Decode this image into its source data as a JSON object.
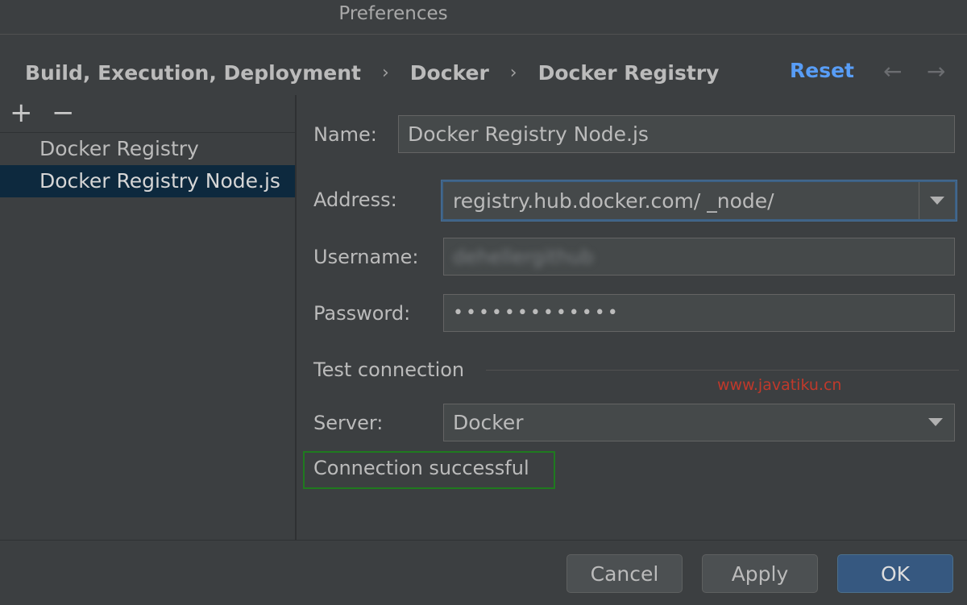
{
  "window": {
    "title": "Preferences"
  },
  "breadcrumb": [
    "Build, Execution, Deployment",
    "Docker",
    "Docker Registry"
  ],
  "header": {
    "reset_label": "Reset",
    "back_glyph": "←",
    "forward_glyph": "→"
  },
  "toolbar": {
    "add_glyph": "+",
    "remove_glyph": "−"
  },
  "registries": [
    "Docker Registry",
    "Docker Registry Node.js"
  ],
  "selected_index": 1,
  "form": {
    "name_label": "Name:",
    "name_value": "Docker Registry Node.js",
    "address_label": "Address:",
    "address_value": "registry.hub.docker.com/ _node/",
    "username_label": "Username:",
    "username_value": "dehellergithub",
    "password_label": "Password:",
    "password_value": "•••••••••••••",
    "test_section_label": "Test connection",
    "server_label": "Server:",
    "server_value": "Docker",
    "status_message": "Connection successful"
  },
  "watermark": "www.javatiku.cn",
  "buttons": {
    "cancel": "Cancel",
    "apply": "Apply",
    "ok": "OK"
  },
  "colors": {
    "accent_link": "#589df6",
    "selection": "#0d293e",
    "success_border": "#1f7a1f",
    "primary_button": "#365880"
  }
}
